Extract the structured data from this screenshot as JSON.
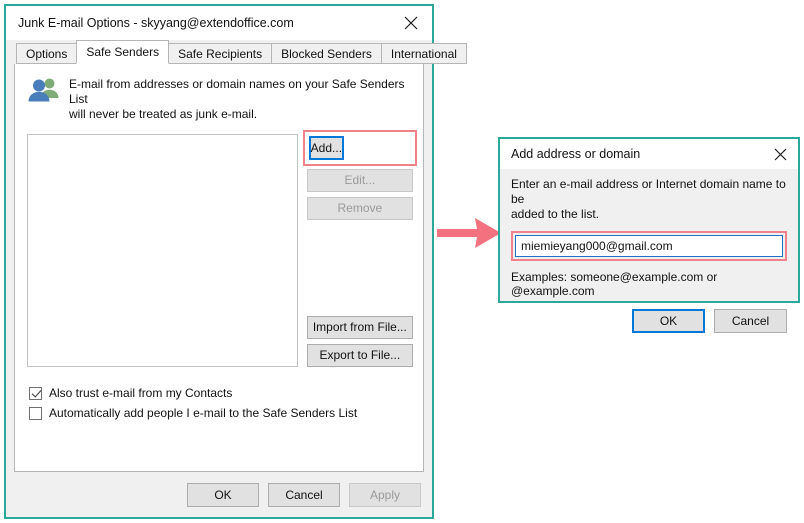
{
  "main_window": {
    "title": "Junk E-mail Options - skyyang@extendoffice.com",
    "close_icon": "close-icon",
    "tabs": [
      {
        "label": "Options",
        "active": false
      },
      {
        "label": "Safe Senders",
        "active": true
      },
      {
        "label": "Safe Recipients",
        "active": false
      },
      {
        "label": "Blocked Senders",
        "active": false
      },
      {
        "label": "International",
        "active": false
      }
    ],
    "info": {
      "icon": "people-icon",
      "line1": "E-mail from addresses or domain names on your Safe Senders List",
      "line2": "will never be treated as junk e-mail."
    },
    "list": {
      "items": [],
      "empty": true
    },
    "side_buttons": [
      {
        "label": "Add...",
        "disabled": false,
        "focused": true,
        "highlighted": true
      },
      {
        "label": "Edit...",
        "disabled": true,
        "focused": false,
        "highlighted": false
      },
      {
        "label": "Remove",
        "disabled": true,
        "focused": false,
        "highlighted": false
      }
    ],
    "file_buttons": [
      {
        "label": "Import from File...",
        "disabled": false
      },
      {
        "label": "Export to File...",
        "disabled": false
      }
    ],
    "checkboxes": [
      {
        "label": "Also trust e-mail from my Contacts",
        "checked": true
      },
      {
        "label": "Automatically add people I e-mail to the Safe Senders List",
        "checked": false
      }
    ],
    "footer_buttons": [
      {
        "label": "OK",
        "disabled": false
      },
      {
        "label": "Cancel",
        "disabled": false
      },
      {
        "label": "Apply",
        "disabled": true
      }
    ]
  },
  "add_dialog": {
    "title": "Add address or domain",
    "close_icon": "close-icon",
    "prompt_line1": "Enter an e-mail address or Internet domain name to be",
    "prompt_line2": "added to the list.",
    "input_value": "miemieyang000@gmail.com",
    "input_placeholder": "",
    "examples": "Examples: someone@example.com or @example.com",
    "buttons": [
      {
        "label": "OK",
        "focused": true
      },
      {
        "label": "Cancel",
        "focused": false
      }
    ]
  },
  "annotations": {
    "arrow": {
      "name": "flow-arrow",
      "direction": "right",
      "color": "#f4727f"
    },
    "highlight_color": "#f1818a",
    "window_border_color": "#2aa89a",
    "focus_color": "#0078d7"
  }
}
